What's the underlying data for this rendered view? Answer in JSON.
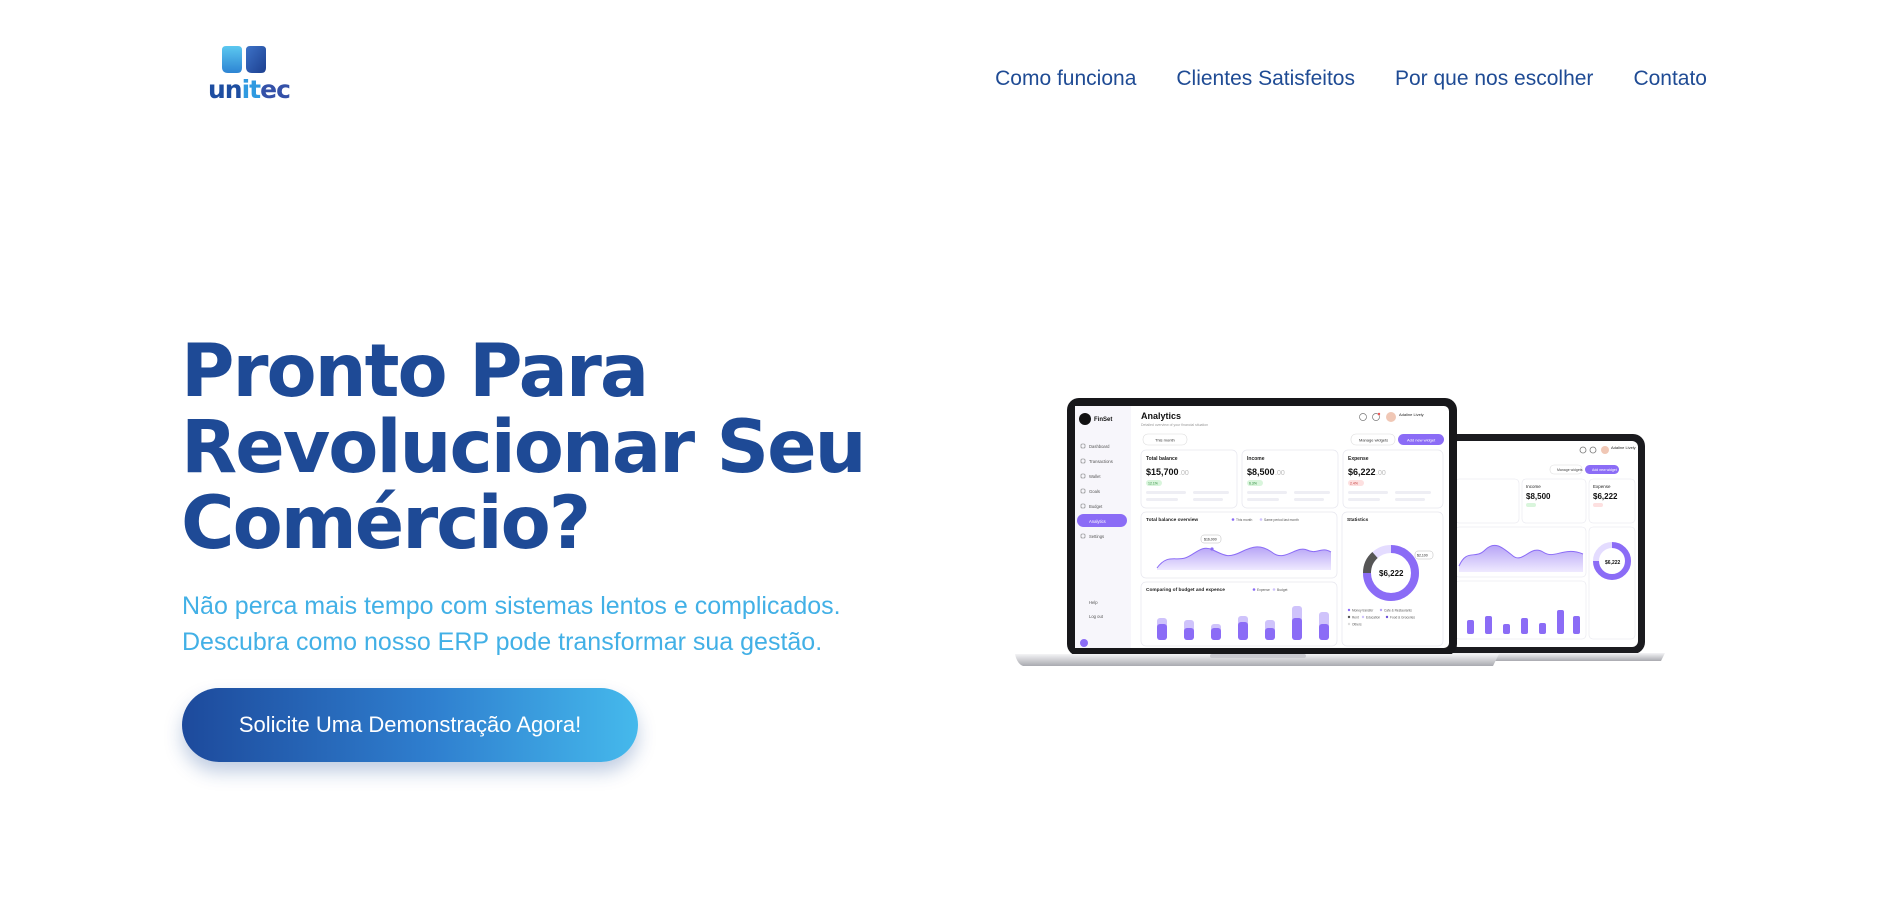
{
  "brand": {
    "logo_parts": [
      "un",
      "it",
      "ec"
    ],
    "logo_alt": "unitec",
    "colors": {
      "primary": "#1e4a96",
      "accent": "#42b0e6"
    }
  },
  "nav": {
    "items": [
      "Como funciona",
      "Clientes Satisfeitos",
      "Por que nos escolher",
      "Contato"
    ]
  },
  "hero": {
    "title_lines": [
      "Pronto Para",
      "Revolucionar Seu",
      "Comércio?"
    ],
    "subtitle_lines": [
      "Não perca mais tempo com sistemas lentos e complicados.",
      "Descubra como nosso ERP pode transformar sua gestão."
    ],
    "cta_label": "Solicite Uma Demonstração Agora!"
  },
  "mockup": {
    "app_name": "FinSet",
    "page_title": "Analytics",
    "page_subtitle": "Detailed overview of your financial situation",
    "date_filter": "This month",
    "manage_widgets": "Manage widgets",
    "add_widget": "Add new widget",
    "user_name": "Adaline Lively",
    "sidebar": [
      "Dashboard",
      "Transactions",
      "Wallet",
      "Goals",
      "Budget",
      "Analytics",
      "Settings"
    ],
    "sidebar_bottom": [
      "Help",
      "Log out"
    ],
    "cards": [
      {
        "title": "Total balance",
        "value": "$15,700",
        "cents": ".00",
        "badge": "12.1%"
      },
      {
        "title": "Income",
        "value": "$8,500",
        "cents": ".00",
        "badge": "6.3%"
      },
      {
        "title": "Expense",
        "value": "$6,222",
        "cents": ".00",
        "badge": "2.4%"
      }
    ],
    "overview_title": "Total balance overview",
    "overview_legend": [
      "This month",
      "Same period last month"
    ],
    "overview_tip": "$16,000",
    "statistics_title": "Statistics",
    "statistics_value": "$6,222",
    "statistics_badge": "$2,100",
    "budget_title": "Comparing of budget and expence",
    "budget_legend": [
      "Expense",
      "Budget"
    ],
    "donut_legend": [
      "Money transfer",
      "Cafe & Restaurants",
      "Rent",
      "Education",
      "Food & Groceries",
      "Others"
    ],
    "tablet_cards": [
      {
        "title": "Income",
        "value": "$8,500"
      },
      {
        "title": "Expense",
        "value": "$6,222"
      }
    ],
    "tablet_statistics_value": "$6,222"
  }
}
